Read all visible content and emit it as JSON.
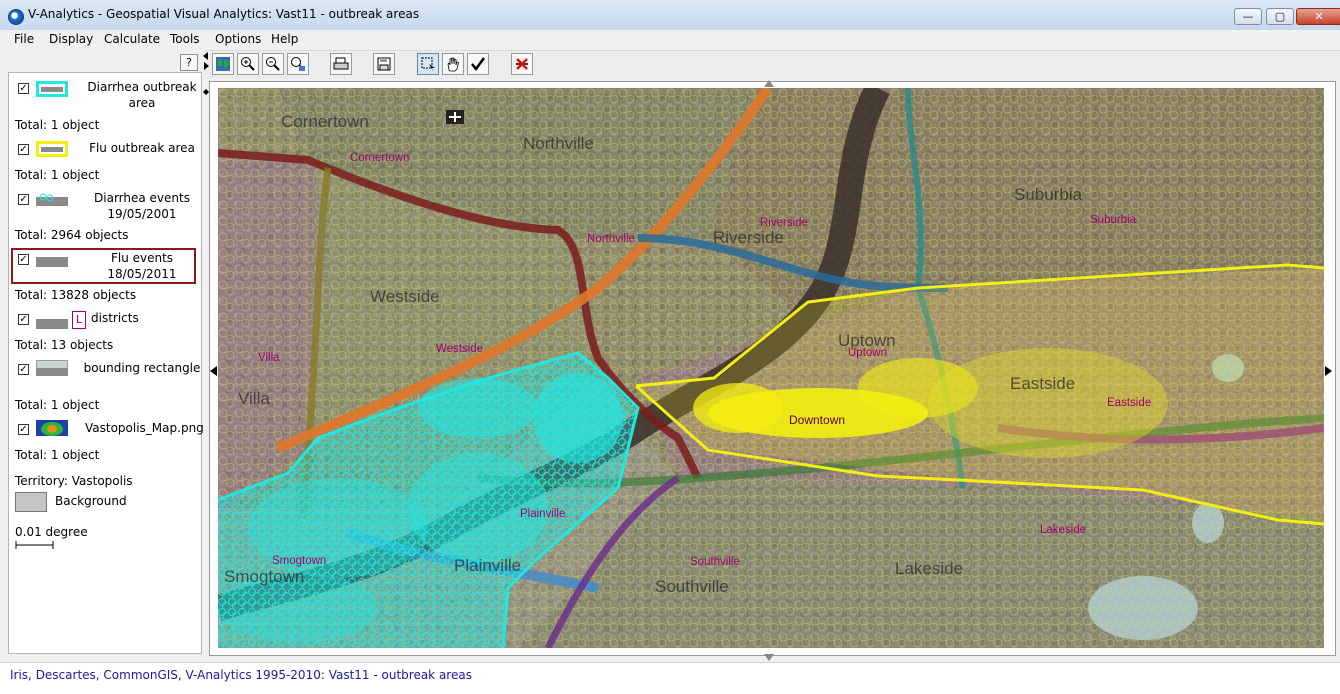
{
  "window": {
    "title": "V-Analytics - Geospatial Visual Analytics: Vast11 - outbreak areas",
    "minimize_glyph": "—",
    "maximize_glyph": "▢",
    "close_glyph": "✕"
  },
  "menu": [
    "File",
    "Display",
    "Calculate",
    "Tools",
    "Options",
    "Help"
  ],
  "help_button": "?",
  "layers": [
    {
      "label": "Diarrhea outbreak area",
      "total": "Total: 1 object",
      "checked": true,
      "swatch": "cyan-outline"
    },
    {
      "label": "Flu outbreak area",
      "total": "Total: 1 object",
      "checked": true,
      "swatch": "yellow-outline"
    },
    {
      "label": "Diarrhea events 19/05/2001",
      "total": "Total: 2964 objects",
      "checked": true,
      "swatch": "cyan-circles"
    },
    {
      "label": "Flu events 18/05/2011",
      "total": "Total: 13828 objects",
      "checked": true,
      "swatch": "grey",
      "selected": true
    },
    {
      "label": "districts",
      "total": "Total: 13 objects",
      "checked": true,
      "swatch": "L-label"
    },
    {
      "label": "bounding rectangle",
      "total": "Total: 1 object",
      "checked": true,
      "swatch": "grey-rect"
    },
    {
      "label": "Vastopolis_Map.png",
      "total": "Total: 1 object",
      "checked": true,
      "swatch": "image"
    }
  ],
  "layer_L_glyph": "L",
  "checkmark": "✓",
  "territory": "Territory: Vastopolis",
  "background_label": "Background",
  "scale_label": "0.01 degree",
  "status": "Iris, Descartes, CommonGIS, V-Analytics 1995-2010: Vast11 - outbreak areas",
  "map": {
    "place_names": [
      "Cornertown",
      "Northville",
      "Suburbia",
      "Riverside",
      "Westside",
      "Uptown",
      "Villa",
      "Eastside",
      "Plainville",
      "Smogtown",
      "Southville",
      "Lakeside"
    ],
    "district_labels": [
      "Cornertown",
      "Northville",
      "Riverside",
      "Suburbia",
      "Westside",
      "Villa",
      "Uptown",
      "Downtown",
      "Eastside",
      "Plainville",
      "Smogtown",
      "Southville",
      "Lakeside"
    ],
    "colors": {
      "diarrhea": "#22e6e0",
      "flu": "#f5ee10",
      "district_label": "#a1006e"
    }
  }
}
